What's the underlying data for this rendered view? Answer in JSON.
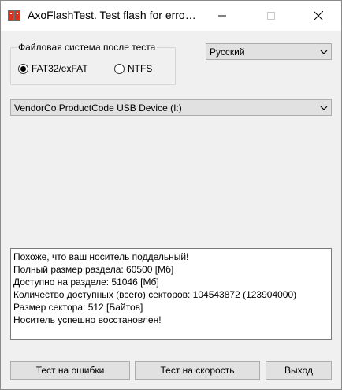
{
  "window": {
    "title": "AxoFlashTest. Test flash for erro…"
  },
  "filesystem_group": {
    "label": "Файловая система после теста",
    "options": [
      {
        "label": "FAT32/exFAT",
        "selected": true
      },
      {
        "label": "NTFS",
        "selected": false
      }
    ]
  },
  "language": {
    "selected": "Русский"
  },
  "device": {
    "selected": "VendorCo ProductCode USB Device (I:)"
  },
  "log": {
    "lines": [
      "Похоже, что ваш носитель поддельный!",
      "Полный размер раздела: 60500 [Мб]",
      "Доступно на разделе: 51046 [Мб]",
      "Количество доступных (всего) секторов: 104543872 (123904000)",
      "Размер сектора: 512 [Байтов]",
      "Носитель успешно восстановлен!"
    ]
  },
  "buttons": {
    "test_errors": "Тест на ошибки",
    "test_speed": "Тест на скорость",
    "exit": "Выход"
  }
}
